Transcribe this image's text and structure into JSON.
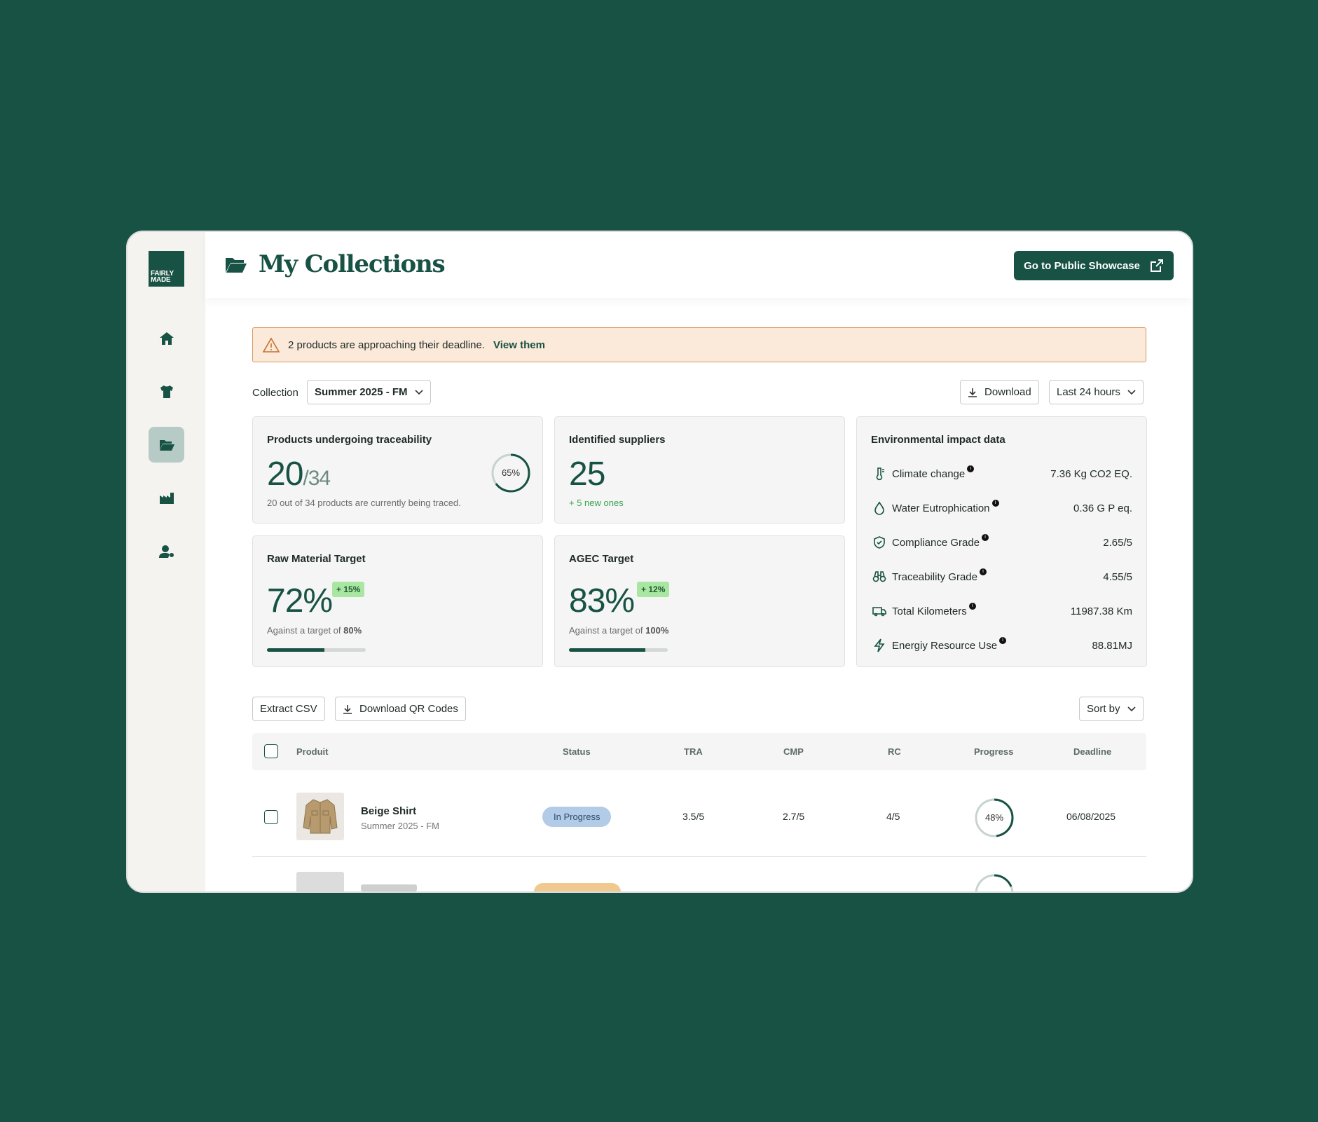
{
  "brand": {
    "logo_text": "FAIRLY MADE"
  },
  "header": {
    "title": "My Collections",
    "showcase_button": "Go to Public Showcase"
  },
  "alert": {
    "message": "2 products are approaching their deadline.",
    "link": "View them"
  },
  "filters": {
    "collection_label": "Collection",
    "collection_value": "Summer 2025 - FM",
    "download_label": "Download",
    "period_value": "Last 24 hours"
  },
  "cards": {
    "traceability": {
      "title": "Products undergoing traceability",
      "value": "20",
      "total": "/34",
      "ring_label": "65%",
      "ring_fraction": 0.65,
      "subtitle": "20 out of 34 products are currently being traced."
    },
    "suppliers": {
      "title": "Identified suppliers",
      "value": "25",
      "subtitle": "+ 5 new ones"
    },
    "raw_material": {
      "title": "Raw Material Target",
      "value": "72%",
      "delta": "+ 15%",
      "subtitle_prefix": "Against a target of ",
      "target": "80%",
      "progress_fraction": 0.58
    },
    "agec": {
      "title": "AGEC Target",
      "value": "83%",
      "delta": "+ 12%",
      "subtitle_prefix": "Against a target of ",
      "target": "100%",
      "progress_fraction": 0.77
    },
    "environment": {
      "title": "Environmental impact data",
      "rows": [
        {
          "icon": "thermometer-icon",
          "label": "Climate change",
          "value": "7.36 Kg CO2 EQ."
        },
        {
          "icon": "droplet-icon",
          "label": "Water Eutrophication",
          "value": "0.36 G P eq."
        },
        {
          "icon": "shield-check-icon",
          "label": "Compliance Grade",
          "value": "2.65/5"
        },
        {
          "icon": "binoculars-icon",
          "label": "Traceability Grade",
          "value": "4.55/5"
        },
        {
          "icon": "truck-icon",
          "label": "Total Kilometers",
          "value": "11987.38 Km"
        },
        {
          "icon": "lightning-icon",
          "label": "Energiy Resource Use",
          "value": "88.81MJ"
        }
      ]
    }
  },
  "actions": {
    "extract_csv": "Extract CSV",
    "download_qr": "Download QR Codes",
    "sort_by": "Sort by"
  },
  "table": {
    "columns": [
      "Produit",
      "Status",
      "TRA",
      "CMP",
      "RC",
      "Progress",
      "Deadline"
    ],
    "rows": [
      {
        "name": "Beige Shirt",
        "collection": "Summer 2025 - FM",
        "status": "In Progress",
        "tra": "3.5/5",
        "cmp": "2.7/5",
        "rc": "4/5",
        "progress_label": "48%",
        "progress_fraction": 0.48,
        "deadline": "06/08/2025"
      }
    ]
  },
  "colors": {
    "brand_green": "#185244",
    "alert_bg": "#fbe9d9",
    "alert_border": "#d89862",
    "delta_bg": "#a9e6a1",
    "status_in_progress": "#b2cbe6"
  }
}
